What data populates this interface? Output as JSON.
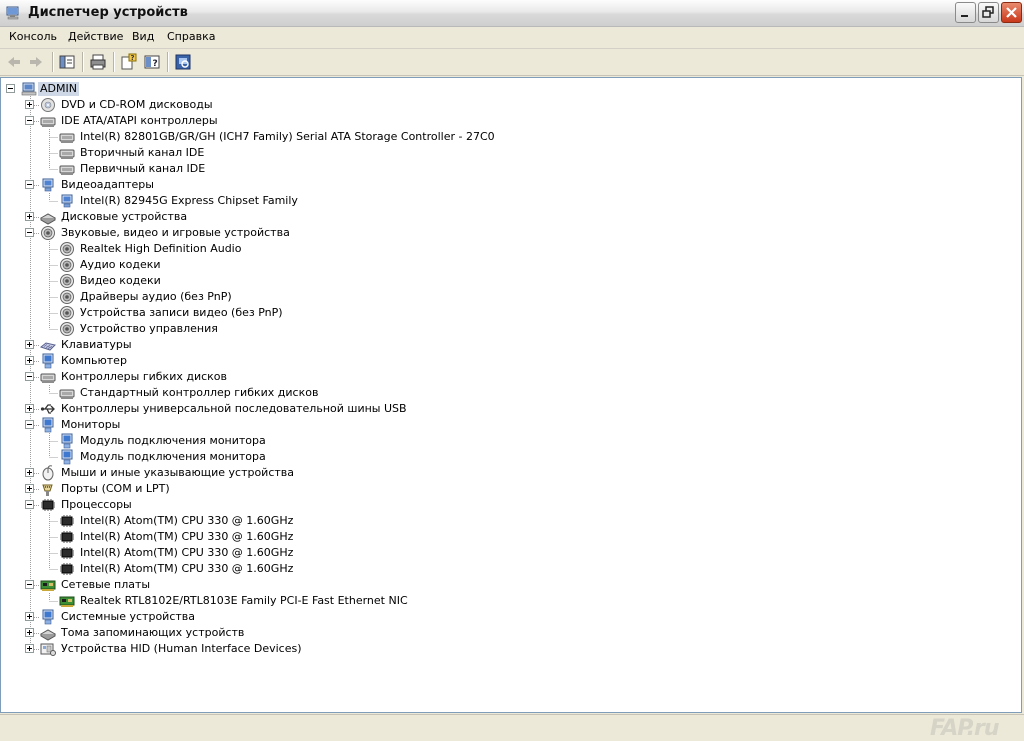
{
  "window": {
    "title": "Диспетчер устройств"
  },
  "menu": [
    "Консоль",
    "Действие",
    "Вид",
    "Справка"
  ],
  "toolbar": [
    "back-arrow-icon",
    "forward-arrow-icon",
    "show-hide-tree-icon",
    "print-icon",
    "properties-icon",
    "help-icon",
    "scan-hardware-icon"
  ],
  "tree": [
    {
      "label": "ADMIN",
      "level": 0,
      "icon": "computer-icon",
      "exp": "minus",
      "selected": true
    },
    {
      "label": "DVD и CD-ROM дисководы",
      "level": 1,
      "icon": "cdrom-icon",
      "exp": "plus"
    },
    {
      "label": "IDE ATA/ATAPI контроллеры",
      "level": 1,
      "icon": "ide-controller-icon",
      "exp": "minus"
    },
    {
      "label": "Intel(R) 82801GB/GR/GH (ICH7 Family) Serial ATA Storage Controller - 27C0",
      "level": 2,
      "icon": "ide-controller-icon"
    },
    {
      "label": "Вторичный канал IDE",
      "level": 2,
      "icon": "ide-controller-icon"
    },
    {
      "label": "Первичный канал IDE",
      "level": 2,
      "icon": "ide-controller-icon"
    },
    {
      "label": "Видеоадаптеры",
      "level": 1,
      "icon": "display-adapter-icon",
      "exp": "minus"
    },
    {
      "label": "Intel(R) 82945G Express Chipset Family",
      "level": 2,
      "icon": "display-adapter-icon"
    },
    {
      "label": "Дисковые устройства",
      "level": 1,
      "icon": "disk-drive-icon",
      "exp": "plus"
    },
    {
      "label": "Звуковые, видео и игровые устройства",
      "level": 1,
      "icon": "sound-icon",
      "exp": "minus"
    },
    {
      "label": "Realtek High Definition Audio",
      "level": 2,
      "icon": "sound-icon"
    },
    {
      "label": "Аудио кодеки",
      "level": 2,
      "icon": "sound-icon"
    },
    {
      "label": "Видео кодеки",
      "level": 2,
      "icon": "sound-icon"
    },
    {
      "label": "Драйверы аудио (без PnP)",
      "level": 2,
      "icon": "sound-icon"
    },
    {
      "label": "Устройства записи видео (без PnP)",
      "level": 2,
      "icon": "sound-icon"
    },
    {
      "label": "Устройство управления",
      "level": 2,
      "icon": "sound-icon"
    },
    {
      "label": "Клавиатуры",
      "level": 1,
      "icon": "keyboard-icon",
      "exp": "plus"
    },
    {
      "label": "Компьютер",
      "level": 1,
      "icon": "monitor-icon",
      "exp": "plus"
    },
    {
      "label": "Контроллеры гибких дисков",
      "level": 1,
      "icon": "ide-controller-icon",
      "exp": "minus"
    },
    {
      "label": "Стандартный контроллер гибких дисков",
      "level": 2,
      "icon": "ide-controller-icon"
    },
    {
      "label": "Контроллеры универсальной последовательной шины USB",
      "level": 1,
      "icon": "usb-icon",
      "exp": "plus"
    },
    {
      "label": "Мониторы",
      "level": 1,
      "icon": "monitor-icon",
      "exp": "minus"
    },
    {
      "label": "Модуль подключения монитора",
      "level": 2,
      "icon": "monitor-icon"
    },
    {
      "label": "Модуль подключения монитора",
      "level": 2,
      "icon": "monitor-icon"
    },
    {
      "label": "Мыши и иные указывающие устройства",
      "level": 1,
      "icon": "mouse-icon",
      "exp": "plus"
    },
    {
      "label": "Порты (COM и LPT)",
      "level": 1,
      "icon": "port-icon",
      "exp": "plus"
    },
    {
      "label": "Процессоры",
      "level": 1,
      "icon": "processor-icon",
      "exp": "minus"
    },
    {
      "label": "Intel(R) Atom(TM) CPU  330   @ 1.60GHz",
      "level": 2,
      "icon": "processor-icon"
    },
    {
      "label": "Intel(R) Atom(TM) CPU  330   @ 1.60GHz",
      "level": 2,
      "icon": "processor-icon"
    },
    {
      "label": "Intel(R) Atom(TM) CPU  330   @ 1.60GHz",
      "level": 2,
      "icon": "processor-icon"
    },
    {
      "label": "Intel(R) Atom(TM) CPU  330   @ 1.60GHz",
      "level": 2,
      "icon": "processor-icon"
    },
    {
      "label": "Сетевые платы",
      "level": 1,
      "icon": "network-card-icon",
      "exp": "minus"
    },
    {
      "label": "Realtek RTL8102E/RTL8103E Family PCI-E Fast Ethernet NIC",
      "level": 2,
      "icon": "network-card-icon"
    },
    {
      "label": "Системные устройства",
      "level": 1,
      "icon": "monitor-icon",
      "exp": "plus"
    },
    {
      "label": "Тома запоминающих устройств",
      "level": 1,
      "icon": "disk-drive-icon",
      "exp": "plus"
    },
    {
      "label": "Устройства HID (Human Interface Devices)",
      "level": 1,
      "icon": "hid-icon",
      "exp": "plus"
    }
  ],
  "watermark": "FAP.ru"
}
